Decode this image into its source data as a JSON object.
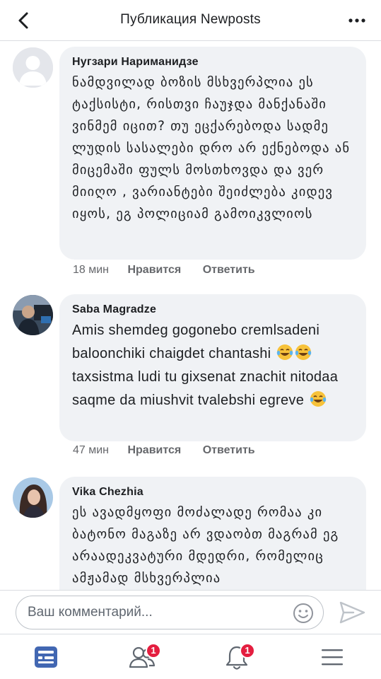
{
  "header": {
    "title": "Публикация Newposts"
  },
  "comments": [
    {
      "author": "Нугзари Нариманидзе",
      "text": "ნამდვილად ბოზის მსხვერპლია ეს ტაქსისტი, რისთვი ჩაუჯდა მანქანაში ვინმემ იცით? თუ ეცქარებოდა სადმე ლუდის სასალები დრო არ ექნებოდა ან მიცემაში ფულს მოსთხოვდა და ვერ მიიღო , ვარიანტები შეიძლება კიდევ იყოს, ეგ პოლიციამ გამოიკვლიოს",
      "time": "18 мин",
      "like": "Нравится",
      "reply": "Ответить"
    },
    {
      "author": "Saba Magradze",
      "text": "Amis shemdeg gogonebo cremlsadeni baloonchiki chaigdet chantashi",
      "text_line_b": "taxsistma ludi tu gixsenat znachit nitodaa saqme da miushvit tvalebshi egreve",
      "time": "47 мин",
      "like": "Нравится",
      "reply": "Ответить"
    },
    {
      "author": "Vika Chezhia",
      "text": "ეს ავადმყოფი მოძალადე რომაა კი ბატონო მაგაზე არ ვდაობთ მაგრამ ეგ არაადეკვატური მდედრი, რომელიც ამჟამად მსხვერპლია"
    }
  ],
  "composer": {
    "placeholder": "Ваш комментарий..."
  },
  "tabs": [
    {
      "name": "news-feed",
      "badge": ""
    },
    {
      "name": "friends",
      "badge": "1"
    },
    {
      "name": "notifications",
      "badge": "1"
    },
    {
      "name": "menu",
      "badge": ""
    }
  ],
  "colors": {
    "accent": "#4267b2",
    "bubble": "#f0f2f5",
    "badge": "#e41e3f",
    "meta_text": "#65676b"
  },
  "icons": [
    "back-icon",
    "more-icon",
    "laughing-tears-emoji",
    "emoji-picker-icon",
    "send-icon",
    "news-feed-icon",
    "friends-icon",
    "bell-icon",
    "menu-icon"
  ]
}
